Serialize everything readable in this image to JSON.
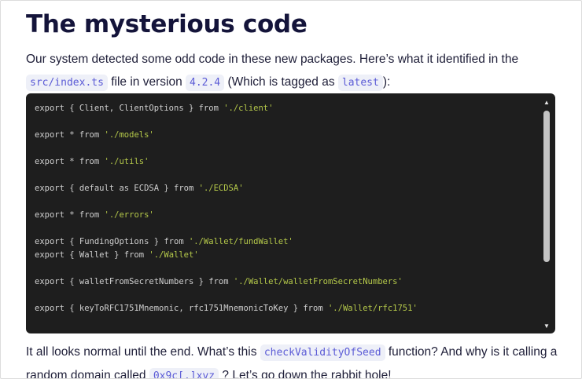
{
  "title": "The mysterious code",
  "intro": {
    "text1": "Our system detected some odd code in these new packages. Here’s what it identified in the",
    "file_code": "src/index.ts",
    "text2": " file in version ",
    "version_code": "4.2.4",
    "text3": " (Which is tagged as ",
    "tag_code": "latest",
    "text4": "):"
  },
  "code": {
    "lines": [
      {
        "pre": "export { Client, ClientOptions } from ",
        "str": "'./client'"
      },
      {
        "pre": "export * from ",
        "str": "'./models'"
      },
      {
        "pre": "export * from ",
        "str": "'./utils'"
      },
      {
        "pre": "export { default as ECDSA } from ",
        "str": "'./ECDSA'"
      },
      {
        "pre": "export * from ",
        "str": "'./errors'"
      },
      {
        "pre": "export { FundingOptions } from ",
        "str": "'./Wallet/fundWallet'"
      },
      {
        "pre": "export { Wallet } from ",
        "str": "'./Wallet'"
      },
      {
        "pre": "export { walletFromSecretNumbers } from ",
        "str": "'./Wallet/walletFromSecretNumbers'"
      },
      {
        "pre": "export { keyToRFC1751Mnemonic, rfc1751MnemonicToKey } from ",
        "str": "'./Wallet/rfc1751'"
      }
    ],
    "scroll_up_icon": "triangle-up",
    "scroll_down_icon": "triangle-down"
  },
  "outro": {
    "text1": "It all looks normal until the end. What’s this ",
    "func_code": "checkValidityOfSeed",
    "text2": " function? And why is it calling a random domain called ",
    "domain_code": "0x9c[.]xyz",
    "text3": " ? Let’s go down the rabbit hole!"
  },
  "colors": {
    "heading": "#14143a",
    "inline_code_bg": "#eef0f8",
    "inline_code_text": "#5b5bd6",
    "code_bg": "#1e1e1e",
    "code_string": "#b5c94a"
  }
}
